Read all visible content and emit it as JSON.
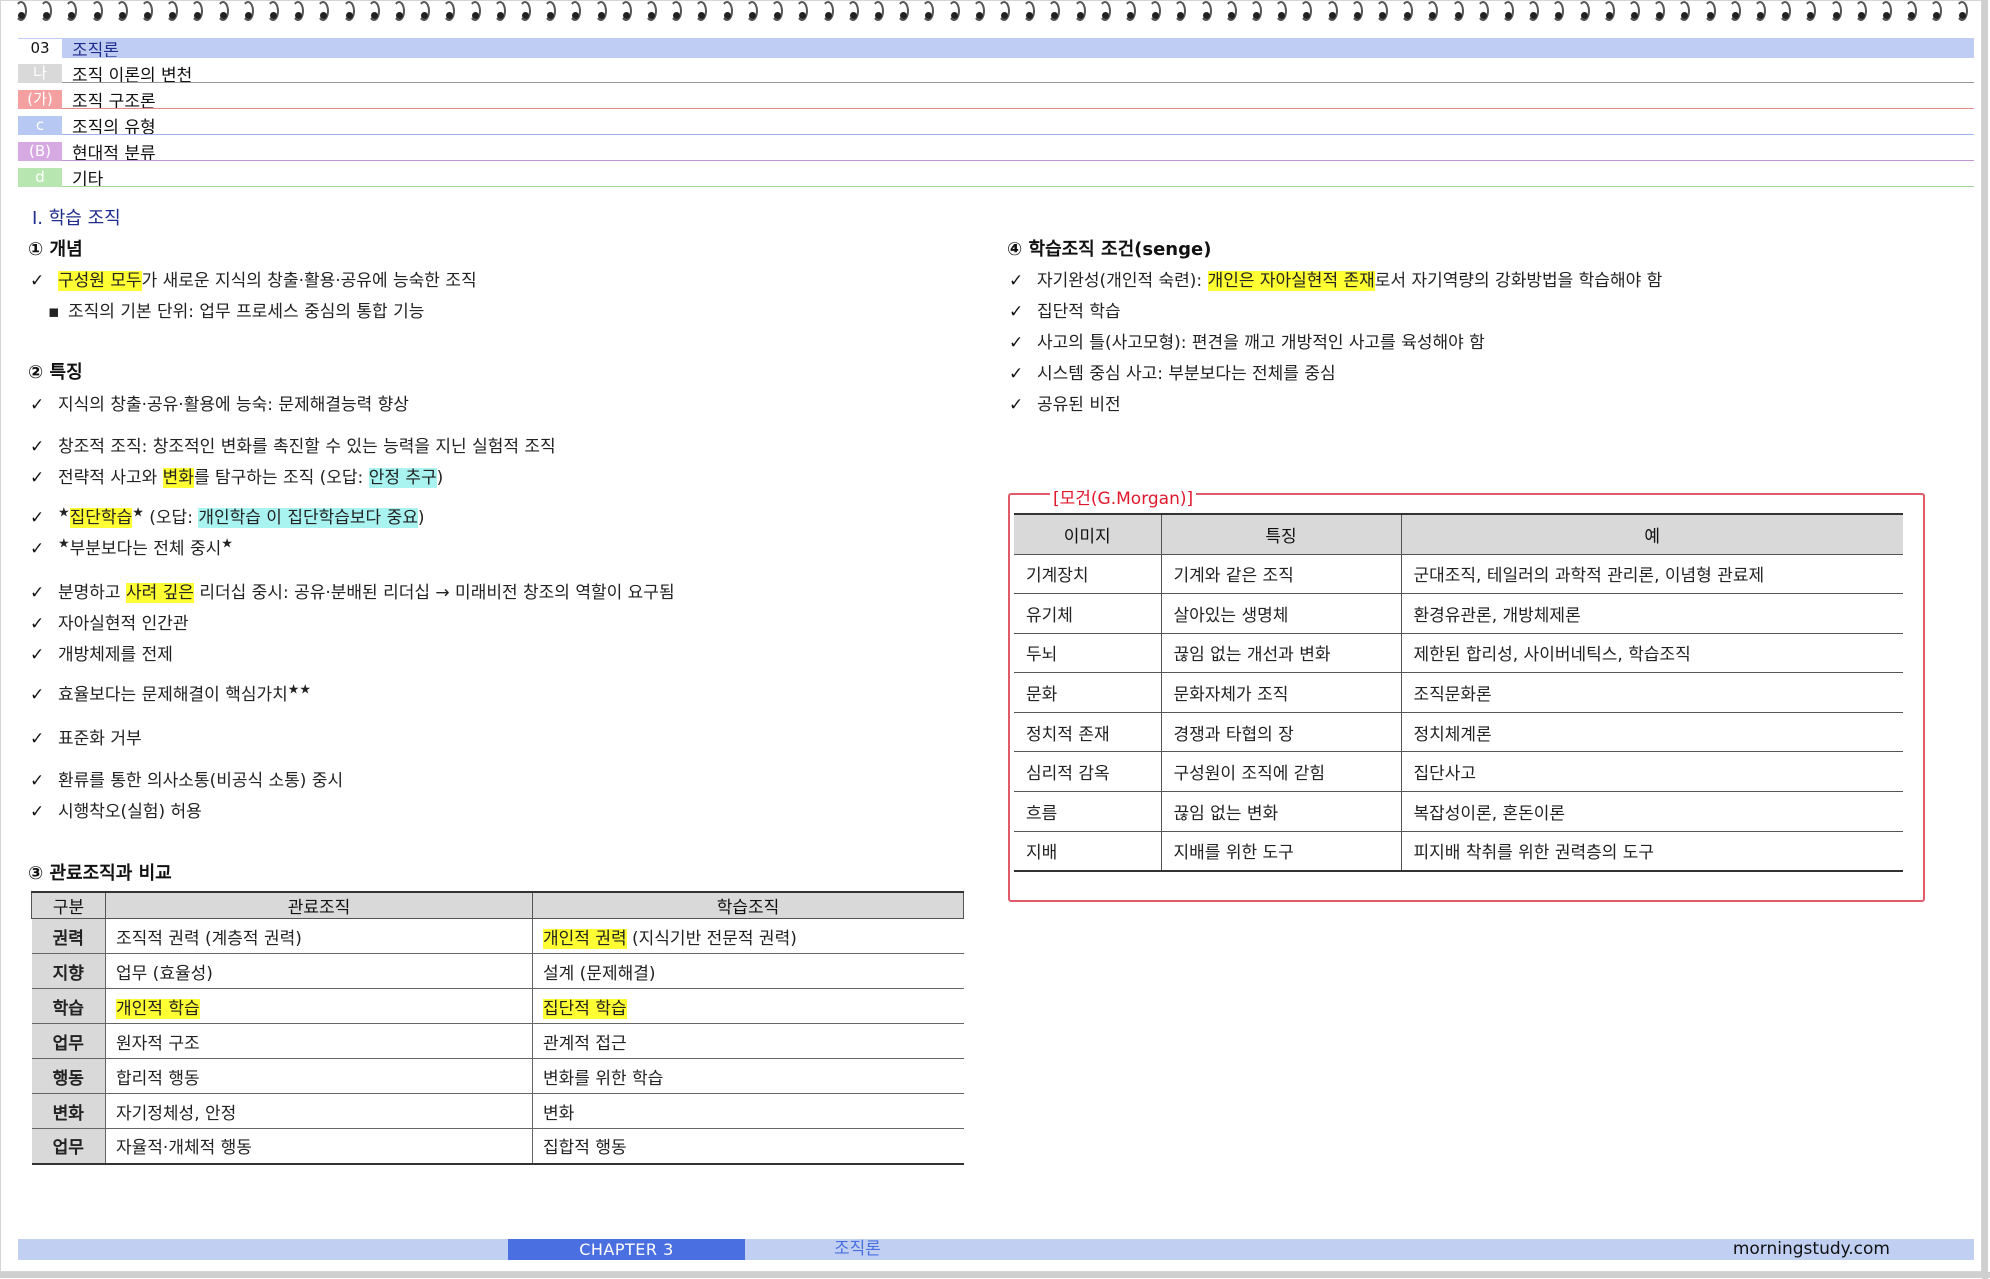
{
  "header": {
    "rows": [
      {
        "tag": "03",
        "text": "조직론",
        "tag_bg": "#ffffff",
        "tag_color": "#111111",
        "row_bg": "#bfcdf5",
        "rule": "#bfcdf5"
      },
      {
        "tag": "나",
        "text": "조직 이론의 변천",
        "tag_bg": "#d9d9d9",
        "tag_color": "#ffffff",
        "row_bg": "#ffffff",
        "rule": "#999999"
      },
      {
        "tag": "(가)",
        "text": "조직 구조론",
        "tag_bg": "#f5a0a0",
        "tag_color": "#ffffff",
        "row_bg": "#ffffff",
        "rule": "#e88a8a"
      },
      {
        "tag": "c",
        "text": "조직의 유형",
        "tag_bg": "#b7c8f3",
        "tag_color": "#ffffff",
        "row_bg": "#ffffff",
        "rule": "#9fb3ea"
      },
      {
        "tag": "(B)",
        "text": "현대적 분류",
        "tag_bg": "#d7a9e3",
        "tag_color": "#ffffff",
        "row_bg": "#ffffff",
        "rule": "#c596d6"
      },
      {
        "tag": "d",
        "text": "기타",
        "tag_bg": "#b8e6b0",
        "tag_color": "#ffffff",
        "row_bg": "#ffffff",
        "rule": "#9fd496"
      }
    ]
  },
  "section_title": "Ⅰ. 학습 조직",
  "concept": {
    "heading": "① 개념",
    "line1_hl": "구성원 모두",
    "line1_rest": "가 새로운 지식의 창출·활용·공유에 능숙한 조직",
    "line2": "조직의 기본 단위: 업무 프로세스 중심의 통합 기능"
  },
  "features": {
    "heading": "② 특징",
    "f1": "지식의 창출·공유·활용에 능숙: 문제해결능력 향상",
    "f2": "창조적 조직: 창조적인 변화를 촉진할 수 있는 능력을 지닌 실험적 조직",
    "f3_a": "전략적 사고와 ",
    "f3_hl": "변화",
    "f3_b": "를 탐구하는 조직 (오답: ",
    "f3_hl2": "안정 추구",
    "f3_c": ")",
    "f4_star": "★",
    "f4_hl": "집단학습",
    "f4_star2": "★",
    "f4_b": " (오답: ",
    "f4_hl2": "개인학습 이 집단학습보다 중요",
    "f4_c": ")",
    "f5_star": "★",
    "f5_text": "부분보다는 전체 중시",
    "f5_star2": "★",
    "f6_a": "분명하고 ",
    "f6_hl": "사려 깊은",
    "f6_b": " 리더십 중시: 공유·분배된 리더십 → 미래비전 창조의 역할이 요구됨",
    "f7": "자아실현적 인간관",
    "f8": "개방체제를 전제",
    "f9": "효율보다는 문제해결이 핵심가치",
    "f9_star": "★★",
    "f10": "표준화 거부",
    "f11": "환류를 통한 의사소통(비공식 소통) 중시",
    "f12": "시행착오(실험) 허용"
  },
  "compare": {
    "heading": "③ 관료조직과 비교",
    "headers": [
      "구분",
      "관료조직",
      "학습조직"
    ],
    "rows": [
      {
        "k": "권력",
        "a": "조직적 권력 (계층적 권력)",
        "b_hl": "개인적 권력",
        "b": " (지식기반 전문적 권력)"
      },
      {
        "k": "지향",
        "a": "업무 (효율성)",
        "b_hl": "",
        "b": "설계 (문제해결)"
      },
      {
        "k": "학습",
        "a_hl": "개인적 학습",
        "a": "",
        "b_hl": "집단적 학습",
        "b": ""
      },
      {
        "k": "업무",
        "a": "원자적 구조",
        "b_hl": "",
        "b": "관계적 접근"
      },
      {
        "k": "행동",
        "a": "합리적 행동",
        "b_hl": "",
        "b": "변화를 위한 학습"
      },
      {
        "k": "변화",
        "a": "자기정체성, 안정",
        "b_hl": "",
        "b": "변화"
      },
      {
        "k": "업무",
        "a": "자율적·개체적 행동",
        "b_hl": "",
        "b": "집합적 행동"
      }
    ]
  },
  "conditions": {
    "heading": "④ 학습조직 조건(senge)",
    "c1_a": "자기완성(개인적 숙련): ",
    "c1_hl": "개인은 자아실현적 존재",
    "c1_b": "로서 자기역량의 강화방법을 학습해야 함",
    "c2": "집단적 학습",
    "c3": "사고의 틀(사고모형): 편견을 깨고 개방적인 사고를 육성해야 함",
    "c4": "시스템 중심 사고: 부분보다는 전체를 중심",
    "c5": "공유된 비전"
  },
  "morgan": {
    "title": "[모건(G.Morgan)]",
    "headers": [
      "이미지",
      "특징",
      "예"
    ],
    "rows": [
      [
        "기계장치",
        "기계와 같은 조직",
        "군대조직, 테일러의 과학적 관리론, 이념형 관료제"
      ],
      [
        "유기체",
        "살아있는 생명체",
        "환경유관론, 개방체제론"
      ],
      [
        "두뇌",
        "끊임 없는 개선과 변화",
        "제한된 합리성, 사이버네틱스, 학습조직"
      ],
      [
        "문화",
        "문화자체가 조직",
        "조직문화론"
      ],
      [
        "정치적 존재",
        "경쟁과 타협의 장",
        "정치체계론"
      ],
      [
        "심리적 감옥",
        "구성원이 조직에 갇힘",
        "집단사고"
      ],
      [
        "흐름",
        "끊임 없는 변화",
        "복잡성이론, 혼돈이론"
      ],
      [
        "지배",
        "지배를 위한 도구",
        "피지배 착취를 위한 권력층의 도구"
      ]
    ]
  },
  "footer": {
    "chapter": "CHAPTER  3",
    "subject": "조직론",
    "site": "morningstudy.com"
  },
  "colors": {
    "highlight_yellow": "#ffff33",
    "highlight_cyan": "#a9f3f0",
    "accent_blue": "#4a6fe0",
    "morgan_red": "#e0182e"
  }
}
